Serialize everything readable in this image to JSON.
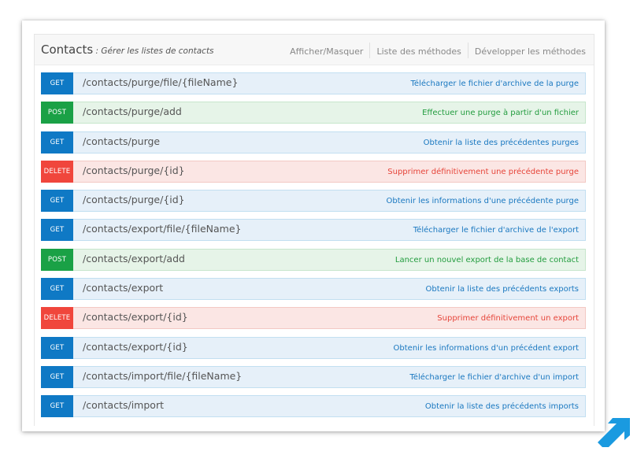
{
  "header": {
    "title": "Contacts",
    "subtitle": " : Gérer les listes de contacts",
    "links": [
      "Afficher/Masquer",
      "Liste des méthodes",
      "Développer les méthodes"
    ]
  },
  "operations": [
    {
      "method": "GET",
      "path": "/contacts/purge/file/{fileName}",
      "description": "Télécharger le fichier d'archive de la purge"
    },
    {
      "method": "POST",
      "path": "/contacts/purge/add",
      "description": "Effectuer une purge à partir d'un fichier"
    },
    {
      "method": "GET",
      "path": "/contacts/purge",
      "description": "Obtenir la liste des précédentes purges"
    },
    {
      "method": "DELETE",
      "path": "/contacts/purge/{id}",
      "description": "Supprimer définitivement une précédente purge"
    },
    {
      "method": "GET",
      "path": "/contacts/purge/{id}",
      "description": "Obtenir les informations d'une précédente purge"
    },
    {
      "method": "GET",
      "path": "/contacts/export/file/{fileName}",
      "description": "Télécharger le fichier d'archive de l'export"
    },
    {
      "method": "POST",
      "path": "/contacts/export/add",
      "description": "Lancer un nouvel export de la base de contact"
    },
    {
      "method": "GET",
      "path": "/contacts/export",
      "description": "Obtenir la liste des précédents exports"
    },
    {
      "method": "DELETE",
      "path": "/contacts/export/{id}",
      "description": "Supprimer définitivement un export"
    },
    {
      "method": "GET",
      "path": "/contacts/export/{id}",
      "description": "Obtenir les informations d'un précédent export"
    },
    {
      "method": "GET",
      "path": "/contacts/import/file/{fileName}",
      "description": "Télécharger le fichier d'archive d'un import"
    },
    {
      "method": "GET",
      "path": "/contacts/import",
      "description": "Obtenir la liste des précédents imports"
    }
  ],
  "colors": {
    "get": "#0f79c5",
    "post": "#1aa146",
    "delete": "#f0463c",
    "corner_icon": "#1a9ae0"
  },
  "icons": {
    "corner": "diagonal-arrow-icon"
  }
}
